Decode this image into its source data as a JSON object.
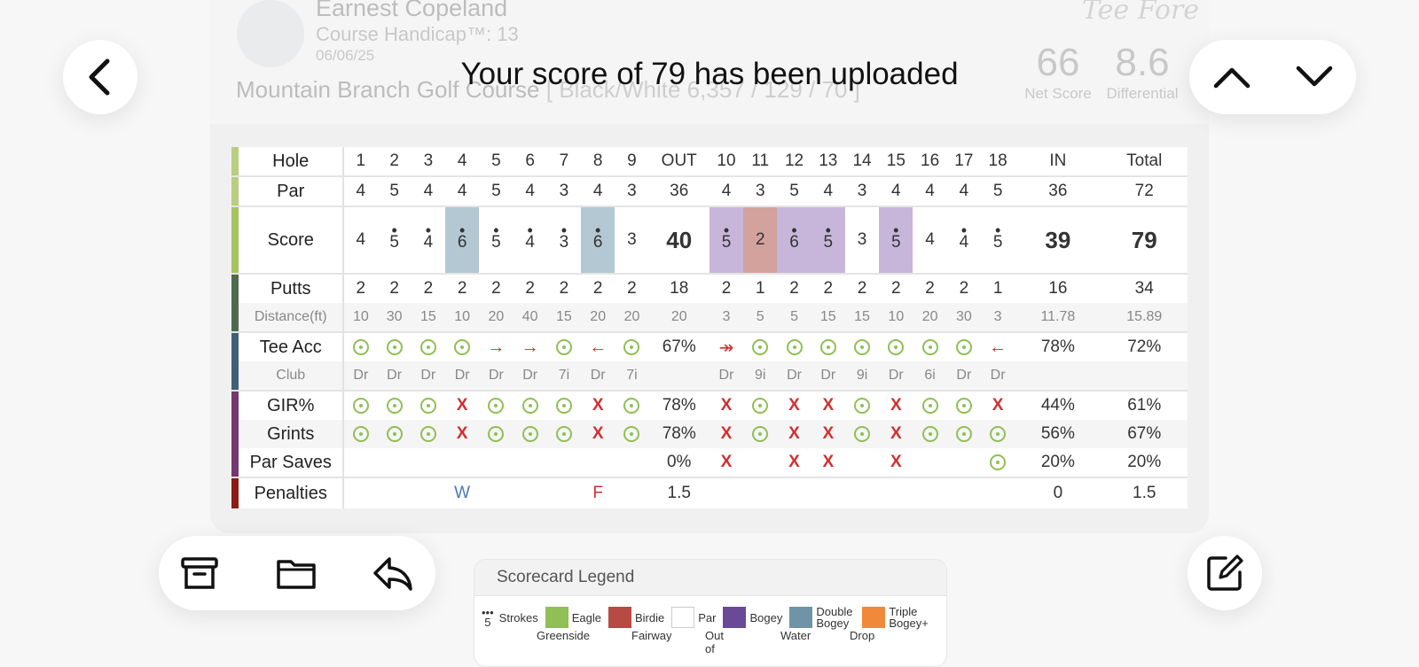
{
  "header": {
    "player_name": "Earnest Copeland",
    "player_handicap": "Course Handicap™: 13",
    "player_date": "06/06/25",
    "brand": "Tee Fore",
    "net_score_value": "66",
    "net_score_label": "Net Score",
    "differential_value": "8.6",
    "differential_label": "Differential",
    "course_name": "Mountain Branch Golf Course",
    "course_details": "[ Black/White 6,357 / 129 / 70 ]"
  },
  "toast": {
    "title": "Your score of 79 has been uploaded"
  },
  "icons": {
    "back": "chevron-left-icon",
    "prev": "chevron-up-icon",
    "next": "chevron-down-icon",
    "archive": "archive-icon",
    "folder": "folder-icon",
    "reply": "reply-icon",
    "compose": "compose-icon"
  },
  "colors": {
    "eagle": "#8fbf55",
    "birdie": "#b84a44",
    "bogey": "#6a4a96",
    "double_bogey": "#6e94a6",
    "triple_bogey": "#f0893a",
    "hit": "#8fbf55",
    "miss": "#d03030"
  },
  "scorecard": {
    "labels": {
      "hole": "Hole",
      "par": "Par",
      "score": "Score",
      "putts": "Putts",
      "distance": "Distance(ft)",
      "tee_acc": "Tee Acc",
      "club": "Club",
      "gir": "GIR%",
      "grints": "Grints",
      "par_saves": "Par Saves",
      "penalties": "Penalties"
    },
    "holes": [
      "1",
      "2",
      "3",
      "4",
      "5",
      "6",
      "7",
      "8",
      "9",
      "OUT",
      "10",
      "11",
      "12",
      "13",
      "14",
      "15",
      "16",
      "17",
      "18",
      "IN",
      "Total"
    ],
    "par": [
      "4",
      "5",
      "4",
      "4",
      "5",
      "4",
      "3",
      "4",
      "3",
      "36",
      "4",
      "3",
      "5",
      "4",
      "3",
      "4",
      "4",
      "4",
      "5",
      "36",
      "72"
    ],
    "score": [
      "4",
      "5",
      "4",
      "6",
      "5",
      "4",
      "3",
      "6",
      "3",
      "40",
      "5",
      "2",
      "6",
      "5",
      "3",
      "5",
      "4",
      "4",
      "5",
      "39",
      "79"
    ],
    "putts": [
      "2",
      "2",
      "2",
      "2",
      "2",
      "2",
      "2",
      "2",
      "2",
      "18",
      "2",
      "1",
      "2",
      "2",
      "2",
      "2",
      "2",
      "2",
      "1",
      "16",
      "34"
    ],
    "distance": [
      "10",
      "30",
      "15",
      "10",
      "20",
      "40",
      "15",
      "20",
      "20",
      "20",
      "3",
      "5",
      "5",
      "15",
      "15",
      "10",
      "20",
      "30",
      "3",
      "11.78",
      "15.89"
    ],
    "tee_acc_summary": [
      "67%",
      "78%",
      "72%"
    ],
    "club": [
      "Dr",
      "Dr",
      "Dr",
      "Dr",
      "Dr",
      "Dr",
      "7i",
      "Dr",
      "7i",
      "",
      "Dr",
      "9i",
      "Dr",
      "Dr",
      "9i",
      "Dr",
      "6i",
      "Dr",
      "Dr",
      "",
      ""
    ],
    "gir_summary": [
      "78%",
      "44%",
      "61%"
    ],
    "grints_summary": [
      "78%",
      "56%",
      "67%"
    ],
    "par_saves_summary": [
      "0%",
      "20%",
      "20%"
    ],
    "penalties_marks": {
      "h4": "W",
      "h8": "F"
    },
    "penalties_summary": [
      "1.5",
      "0",
      "1.5"
    ]
  },
  "legend": {
    "title": "Scorecard Legend",
    "strokes_sample": "5",
    "strokes": "Strokes",
    "eagle": "Eagle",
    "birdie": "Birdie",
    "par": "Par",
    "bogey": "Bogey",
    "double_bogey": "Double Bogey",
    "triple_bogey": "Triple Bogey+",
    "greenside": "Greenside",
    "fairway": "Fairway",
    "out_of": "Out of",
    "water": "Water",
    "drop": "Drop"
  }
}
